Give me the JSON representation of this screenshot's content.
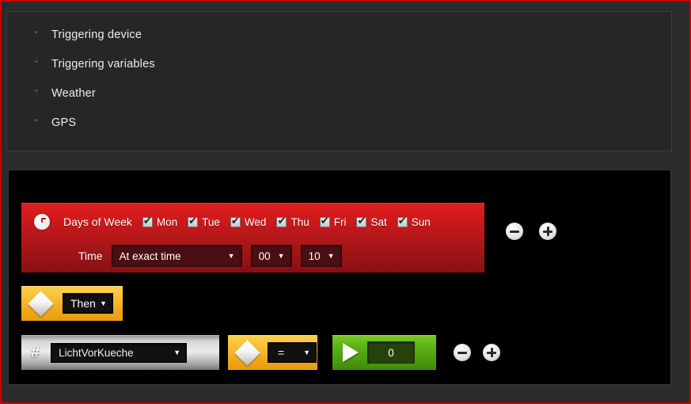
{
  "window": {
    "border_color": "#cc0000",
    "background": "#2b2b2b"
  },
  "top_panel": {
    "items": [
      {
        "label": "Triggering device",
        "chevron": "ˇ"
      },
      {
        "label": "Triggering variables",
        "chevron": "ˇ"
      },
      {
        "label": "Weather",
        "chevron": "ˇ"
      },
      {
        "label": "GPS",
        "chevron": "ˇ"
      }
    ]
  },
  "rules": {
    "trigger_block": {
      "color": "#cc1a1c",
      "icon": "clock-icon",
      "days_label": "Days of Week",
      "days": [
        {
          "name": "Mon",
          "checked": true
        },
        {
          "name": "Tue",
          "checked": true
        },
        {
          "name": "Wed",
          "checked": true
        },
        {
          "name": "Thu",
          "checked": true
        },
        {
          "name": "Fri",
          "checked": true
        },
        {
          "name": "Sat",
          "checked": true
        },
        {
          "name": "Sun",
          "checked": true
        }
      ],
      "time_label": "Time",
      "time_mode": "At exact time",
      "time_hour": "00",
      "time_minute": "10",
      "arrow": "▼",
      "remove_button": "minus-icon",
      "add_button": "plus-icon"
    },
    "then_block": {
      "color": "#f2b21e",
      "icon": "diamond-icon",
      "value": "Then",
      "arrow": "▼"
    },
    "action_row": {
      "variable_block": {
        "color": "#c8c8c8",
        "icon": "hash-icon",
        "icon_glyph": "#",
        "value": "LichtVorKueche",
        "arrow": "▼"
      },
      "operator_block": {
        "color": "#f2b21e",
        "icon": "diamond-icon",
        "value": "=",
        "arrow": "▼"
      },
      "value_block": {
        "color": "#5fb516",
        "icon": "play-icon",
        "value": "0"
      },
      "remove_button": "minus-icon",
      "add_button": "plus-icon"
    }
  }
}
